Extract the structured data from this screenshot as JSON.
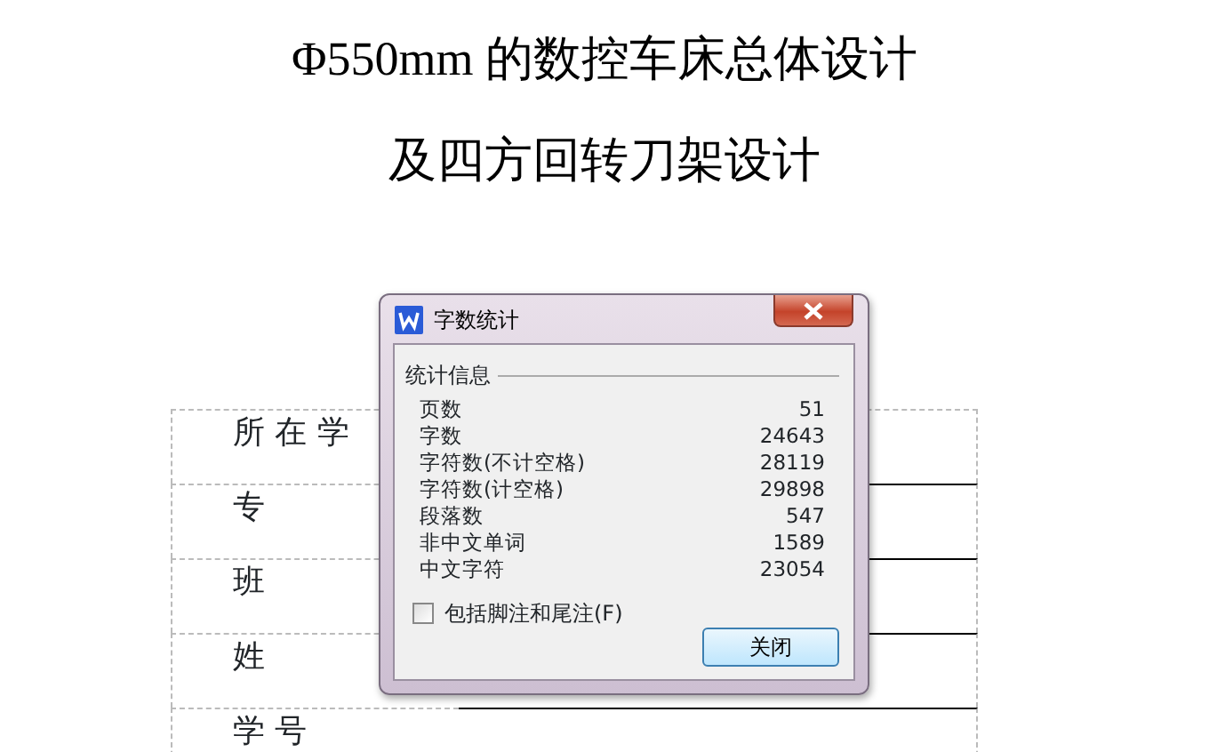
{
  "document": {
    "title_lines": [
      "Φ550mm 的数控车床总体设计",
      "及四方回转刀架设计"
    ],
    "form_rows": [
      {
        "label": "所 在 学"
      },
      {
        "label": "专"
      },
      {
        "label": "班"
      },
      {
        "label": "姓"
      },
      {
        "label": "学 号"
      }
    ]
  },
  "dialog": {
    "title": "字数统计",
    "group": "统计信息",
    "stats": [
      {
        "name": "页数",
        "value": "51"
      },
      {
        "name": "字数",
        "value": "24643"
      },
      {
        "name": "字符数(不计空格)",
        "value": "28119"
      },
      {
        "name": "字符数(计空格)",
        "value": "29898"
      },
      {
        "name": "段落数",
        "value": "547"
      },
      {
        "name": "非中文单词",
        "value": "1589"
      },
      {
        "name": "中文字符",
        "value": "23054"
      }
    ],
    "checkbox": {
      "label": "包括脚注和尾注(F)",
      "checked": false
    },
    "button": "关闭"
  }
}
